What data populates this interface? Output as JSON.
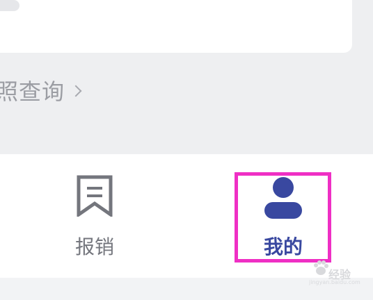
{
  "query_link": {
    "label": "照查询",
    "chevron_icon": "chevron-right-icon"
  },
  "tab_bar": {
    "items": [
      {
        "label": "报销",
        "icon": "bookmark-list-icon",
        "color": "#74767d",
        "selected": false
      },
      {
        "label": "我的",
        "icon": "user-profile-icon",
        "color": "#3948a0",
        "selected": true
      }
    ],
    "highlight_color": "#ef2fc4"
  },
  "watermark": {
    "text": "经验",
    "url": "jingyan.baidu.com"
  }
}
